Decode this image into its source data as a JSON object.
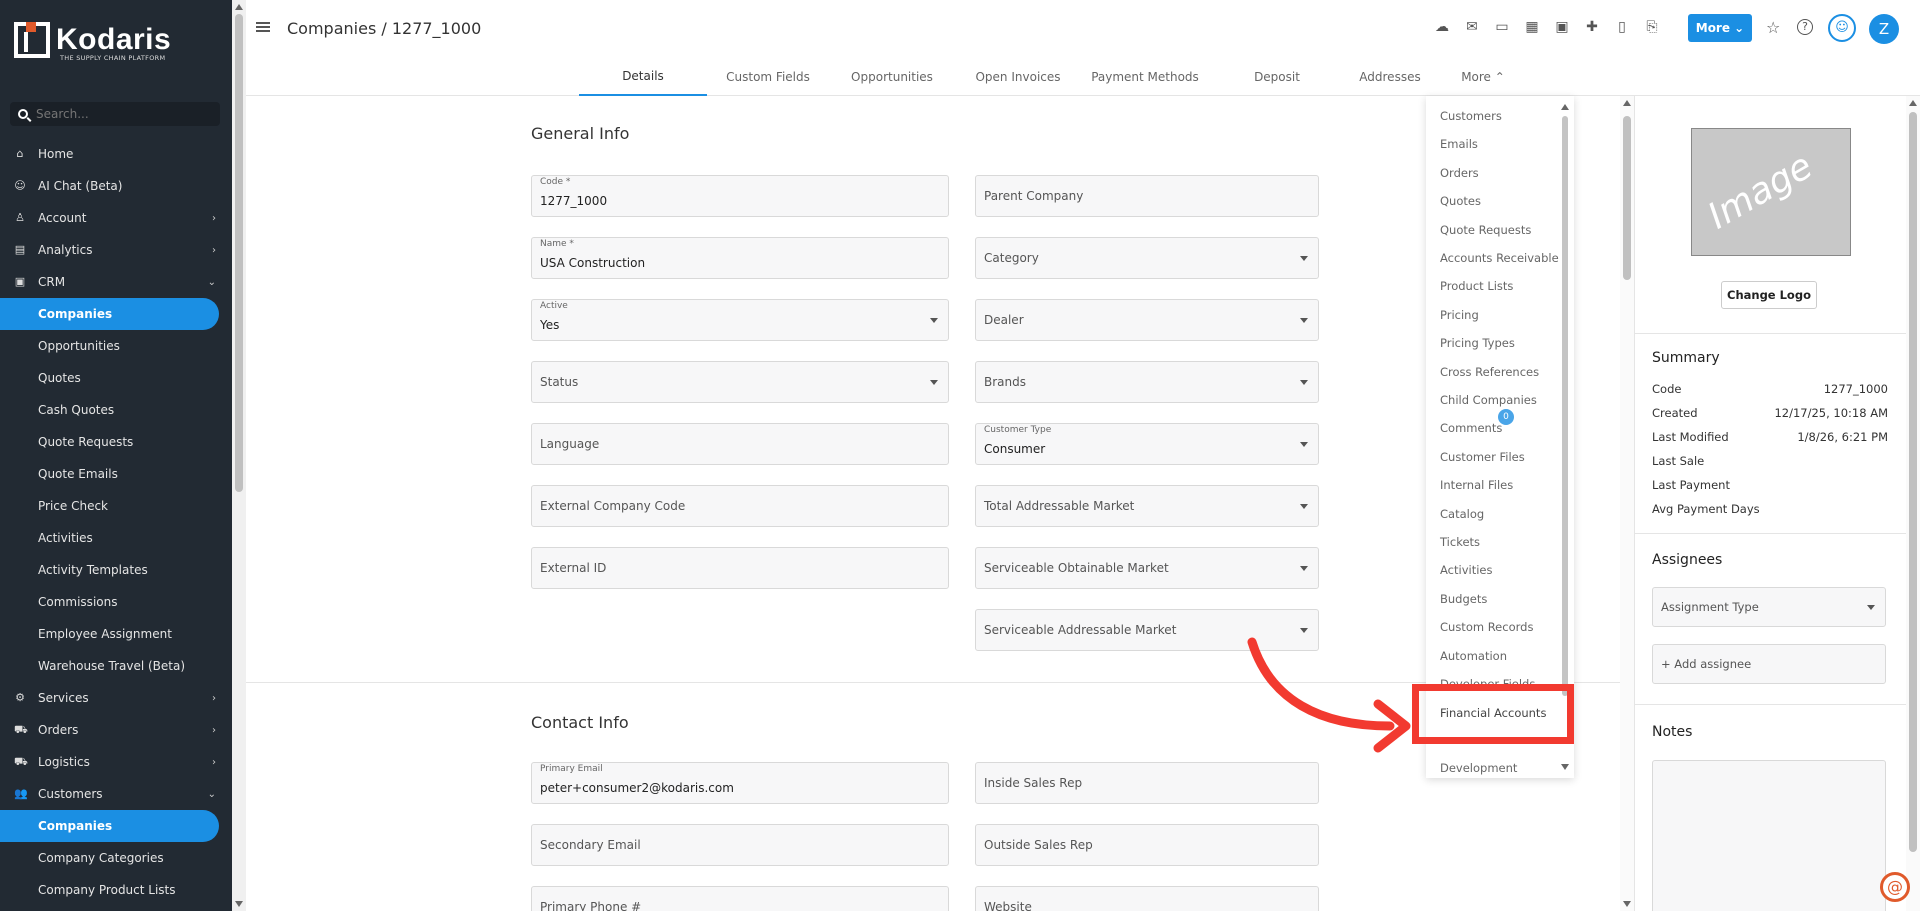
{
  "sidebar": {
    "logo_text": "Kodaris",
    "logo_tagline": "THE SUPPLY CHAIN PLATFORM",
    "search_placeholder": "Search...",
    "items": [
      {
        "label": "Home",
        "icon": "home-icon",
        "glyph": "⌂"
      },
      {
        "label": "AI Chat (Beta)",
        "icon": "robot-icon",
        "glyph": "☺"
      },
      {
        "label": "Account",
        "icon": "user-icon",
        "glyph": "♙",
        "chevron": "›"
      },
      {
        "label": "Analytics",
        "icon": "chart-icon",
        "glyph": "▤",
        "chevron": "›"
      },
      {
        "label": "CRM",
        "icon": "crm-icon",
        "glyph": "▣",
        "chevron": "⌄"
      },
      {
        "label": "Companies",
        "sub": true,
        "active": true
      },
      {
        "label": "Opportunities",
        "sub": true
      },
      {
        "label": "Quotes",
        "sub": true
      },
      {
        "label": "Cash Quotes",
        "sub": true
      },
      {
        "label": "Quote Requests",
        "sub": true
      },
      {
        "label": "Quote Emails",
        "sub": true
      },
      {
        "label": "Price Check",
        "sub": true
      },
      {
        "label": "Activities",
        "sub": true
      },
      {
        "label": "Activity Templates",
        "sub": true
      },
      {
        "label": "Commissions",
        "sub": true
      },
      {
        "label": "Employee Assignment",
        "sub": true
      },
      {
        "label": "Warehouse Travel (Beta)",
        "sub": true
      },
      {
        "label": "Services",
        "icon": "services-icon",
        "glyph": "⚙",
        "chevron": "›"
      },
      {
        "label": "Orders",
        "icon": "orders-icon",
        "glyph": "⛟",
        "chevron": "›"
      },
      {
        "label": "Logistics",
        "icon": "logistics-icon",
        "glyph": "⛟",
        "chevron": "›"
      },
      {
        "label": "Customers",
        "icon": "customers-icon",
        "glyph": "👥",
        "chevron": "⌄"
      },
      {
        "label": "Companies",
        "sub": true,
        "active": true
      },
      {
        "label": "Company Categories",
        "sub": true
      },
      {
        "label": "Company Product Lists",
        "sub": true
      }
    ]
  },
  "header": {
    "title": "Companies / 1277_1000",
    "more_button": "More ⌄",
    "avatar_letter": "Z",
    "icons": [
      "cloud-icon",
      "mail-icon",
      "payment-icon",
      "register-icon",
      "screen-icon",
      "add-user-icon",
      "document-icon",
      "attachment-icon"
    ],
    "icon_glyphs": [
      "☁",
      "✉",
      "▭",
      "▦",
      "▣",
      "✚",
      "▯",
      "⎘"
    ]
  },
  "tabs": [
    {
      "label": "Details",
      "active": true
    },
    {
      "label": "Custom Fields"
    },
    {
      "label": "Opportunities"
    },
    {
      "label": "Open Invoices"
    },
    {
      "label": "Payment Methods"
    },
    {
      "label": "Deposit"
    },
    {
      "label": "Addresses"
    },
    {
      "label": "More ⌃"
    }
  ],
  "general_info": {
    "title": "General Info",
    "left": [
      {
        "label": "Code *",
        "value": "1277_1000"
      },
      {
        "label": "Name *",
        "value": "USA Construction"
      },
      {
        "label": "Active",
        "value": "Yes",
        "select": true
      },
      {
        "placeholder": "Status",
        "select": true
      },
      {
        "placeholder": "Language"
      },
      {
        "placeholder": "External Company Code"
      },
      {
        "placeholder": "External ID"
      }
    ],
    "right": [
      {
        "placeholder": "Parent Company"
      },
      {
        "placeholder": "Category",
        "select": true
      },
      {
        "placeholder": "Dealer",
        "select": true
      },
      {
        "placeholder": "Brands",
        "select": true
      },
      {
        "label": "Customer Type",
        "value": "Consumer",
        "select": true
      },
      {
        "placeholder": "Total Addressable Market",
        "select": true
      },
      {
        "placeholder": "Serviceable Obtainable Market",
        "select": true
      },
      {
        "placeholder": "Serviceable Addressable Market",
        "select": true
      }
    ]
  },
  "contact_info": {
    "title": "Contact Info",
    "left": [
      {
        "label": "Primary Email",
        "value": "peter+consumer2@kodaris.com"
      },
      {
        "placeholder": "Secondary Email"
      },
      {
        "placeholder": "Primary Phone #"
      }
    ],
    "right": [
      {
        "placeholder": "Inside Sales Rep"
      },
      {
        "placeholder": "Outside Sales Rep"
      },
      {
        "placeholder": "Website"
      }
    ]
  },
  "more_menu": {
    "items": [
      "Customers",
      "Emails",
      "Orders",
      "Quotes",
      "Quote Requests",
      "Accounts Receivable",
      "Product Lists",
      "Pricing",
      "Pricing Types",
      "Cross References",
      "Child Companies",
      "Comments",
      "Customer Files",
      "Internal Files",
      "Catalog",
      "Tickets",
      "Activities",
      "Budgets",
      "Custom Records",
      "Automation",
      "Developer Fields"
    ],
    "comments_count": "0",
    "highlighted": "Financial Accounts",
    "last": "Development"
  },
  "right_panel": {
    "image_text": "Image",
    "change_logo": "Change Logo",
    "summary_title": "Summary",
    "summary": [
      {
        "k": "Code",
        "v": "1277_1000"
      },
      {
        "k": "Created",
        "v": "12/17/25, 10:18 AM"
      },
      {
        "k": "Last Modified",
        "v": "1/8/26, 6:21 PM"
      },
      {
        "k": "Last Sale",
        "v": ""
      },
      {
        "k": "Last Payment",
        "v": ""
      },
      {
        "k": "Avg Payment Days",
        "v": ""
      }
    ],
    "assignees_title": "Assignees",
    "assignment_type": "Assignment Type",
    "add_assignee": "+ Add assignee",
    "notes_title": "Notes"
  },
  "colors": {
    "accent": "#1b8fe3",
    "sidebar": "#222a33",
    "annotation": "#f23a30"
  }
}
